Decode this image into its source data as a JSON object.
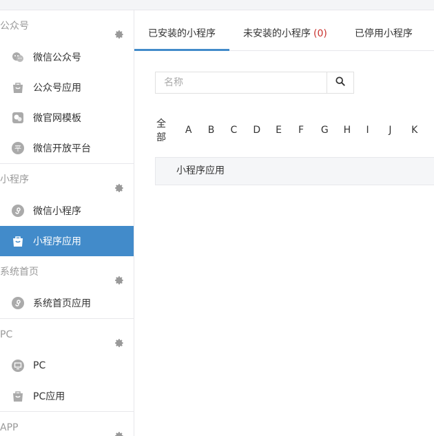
{
  "sidebar": {
    "groups": [
      {
        "title": "公众号",
        "items": [
          {
            "label": "微信公众号",
            "icon": "wechat-icon"
          },
          {
            "label": "公众号应用",
            "icon": "app-bag-icon"
          },
          {
            "label": "微官网模板",
            "icon": "template-icon"
          },
          {
            "label": "微信开放平台",
            "icon": "open-platform-icon"
          }
        ]
      },
      {
        "title": "小程序",
        "items": [
          {
            "label": "微信小程序",
            "icon": "miniprogram-icon"
          },
          {
            "label": "小程序应用",
            "icon": "app-bag-icon",
            "active": true
          }
        ]
      },
      {
        "title": "系统首页",
        "items": [
          {
            "label": "系统首页应用",
            "icon": "miniprogram-icon"
          }
        ]
      },
      {
        "title": "PC",
        "items": [
          {
            "label": "PC",
            "icon": "monitor-icon"
          },
          {
            "label": "PC应用",
            "icon": "app-bag-icon"
          }
        ]
      },
      {
        "title": "APP",
        "items": []
      }
    ]
  },
  "tabs": [
    {
      "label": "已安装的小程序",
      "active": true
    },
    {
      "label": "未安装的小程序",
      "count": "(0)"
    },
    {
      "label": "已停用小程序"
    }
  ],
  "search": {
    "placeholder": "名称",
    "value": ""
  },
  "letters": {
    "all_label": "全部",
    "items": [
      "A",
      "B",
      "C",
      "D",
      "E",
      "F",
      "G",
      "H",
      "I",
      "J",
      "K"
    ]
  },
  "table": {
    "header": "小程序应用"
  },
  "colors": {
    "accent": "#428bca",
    "count_red": "#c9302c"
  }
}
